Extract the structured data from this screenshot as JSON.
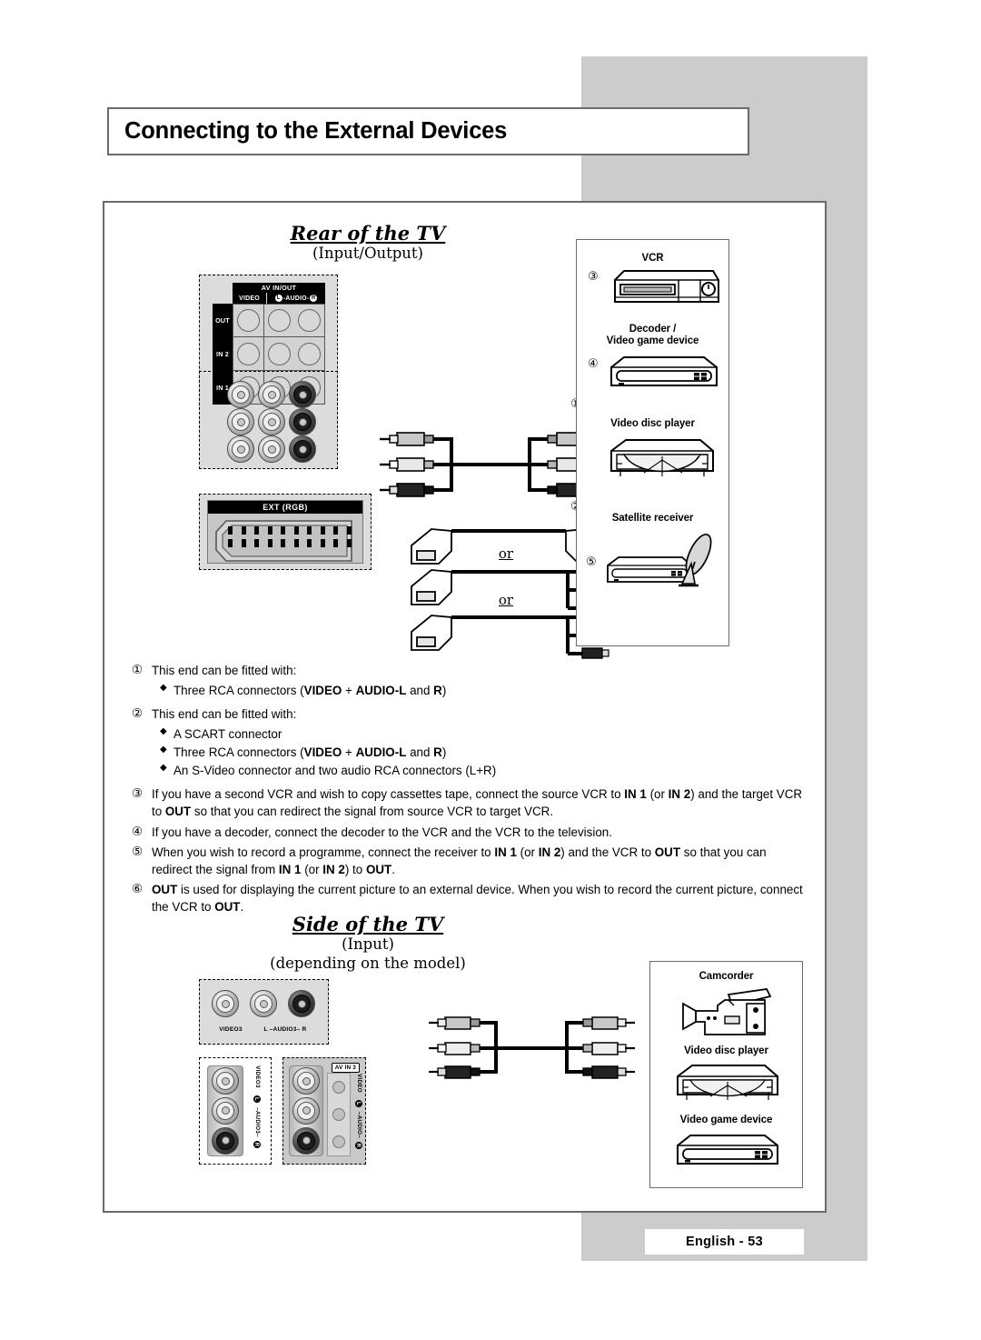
{
  "page": {
    "title": "Connecting to the External Devices",
    "footer": "English - 53"
  },
  "rear_section": {
    "heading": "Rear of the TV",
    "subheading": "(Input/Output)",
    "av_panel": {
      "title": "AV IN/OUT",
      "col_video": "VIDEO",
      "col_audio_left": "L",
      "col_audio_text": "-AUDIO-",
      "col_audio_right": "R",
      "rows": [
        "OUT",
        "IN 2",
        "IN 1"
      ]
    },
    "ext_connector": {
      "label": "EXT (RGB)"
    },
    "cable_marks": {
      "end_one": "①",
      "end_two": "②"
    },
    "or_labels": [
      "or",
      "or"
    ],
    "devices": [
      {
        "num": "③",
        "label": "VCR",
        "icon": "vcr-icon"
      },
      {
        "num": "④",
        "label": "Decoder /\nVideo game device",
        "label_line1": "Decoder /",
        "label_line2": "Video game device",
        "icon": "decoder-icon"
      },
      {
        "num": "",
        "label": "Video disc player",
        "icon": "video-disc-player-icon"
      },
      {
        "num": "⑤",
        "label": "Satellite receiver",
        "icon": "satellite-receiver-icon"
      }
    ]
  },
  "notes": [
    {
      "num": "①",
      "text": "This end can be fitted with:",
      "bullets": [
        {
          "parts": [
            {
              "t": "Three RCA connectors (",
              "b": false
            },
            {
              "t": "VIDEO",
              "b": true
            },
            {
              "t": " + ",
              "b": false
            },
            {
              "t": "AUDIO",
              "b": true
            },
            {
              "t": "-L",
              "b": true
            },
            {
              "t": " and ",
              "b": false
            },
            {
              "t": "R",
              "b": true
            },
            {
              "t": ")",
              "b": false
            }
          ]
        }
      ]
    },
    {
      "num": "②",
      "text": "This end can be fitted with:",
      "bullets": [
        {
          "parts": [
            {
              "t": "A SCART connector",
              "b": false
            }
          ]
        },
        {
          "parts": [
            {
              "t": "Three RCA connectors (",
              "b": false
            },
            {
              "t": "VIDEO",
              "b": true
            },
            {
              "t": " + ",
              "b": false
            },
            {
              "t": "AUDIO",
              "b": true
            },
            {
              "t": "-L",
              "b": true
            },
            {
              "t": " and ",
              "b": false
            },
            {
              "t": "R",
              "b": true
            },
            {
              "t": ")",
              "b": false
            }
          ]
        },
        {
          "parts": [
            {
              "t": "An S-Video connector and two audio RCA connectors (L+R)",
              "b": false
            }
          ]
        }
      ]
    },
    {
      "num": "③",
      "parts": [
        {
          "t": "If you have a second VCR and wish to copy cassettes tape, connect the source VCR to ",
          "b": false
        },
        {
          "t": "IN 1",
          "b": true
        },
        {
          "t": " (or ",
          "b": false
        },
        {
          "t": "IN 2",
          "b": true
        },
        {
          "t": ") and the target VCR to ",
          "b": false
        },
        {
          "t": "OUT",
          "b": true
        },
        {
          "t": " so that you can redirect the signal from source VCR to target VCR.",
          "b": false
        }
      ]
    },
    {
      "num": "④",
      "parts": [
        {
          "t": "If you have a decoder, connect the decoder to the VCR and the VCR to the television.",
          "b": false
        }
      ]
    },
    {
      "num": "⑤",
      "parts": [
        {
          "t": "When you wish to record a programme, connect the receiver to ",
          "b": false
        },
        {
          "t": "IN 1",
          "b": true
        },
        {
          "t": " (or ",
          "b": false
        },
        {
          "t": "IN 2",
          "b": true
        },
        {
          "t": ") and the VCR to ",
          "b": false
        },
        {
          "t": "OUT",
          "b": true
        },
        {
          "t": " so that you can redirect the signal from ",
          "b": false
        },
        {
          "t": "IN 1",
          "b": true
        },
        {
          "t": " (or ",
          "b": false
        },
        {
          "t": "IN 2",
          "b": true
        },
        {
          "t": ") to ",
          "b": false
        },
        {
          "t": "OUT",
          "b": true
        },
        {
          "t": ".",
          "b": false
        }
      ]
    },
    {
      "num": "⑥",
      "parts": [
        {
          "t": "OUT",
          "b": true
        },
        {
          "t": " is used for displaying the current picture to an external device. When you wish to record the current picture, connect the VCR to ",
          "b": false
        },
        {
          "t": "OUT",
          "b": true
        },
        {
          "t": ".",
          "b": false
        }
      ]
    }
  ],
  "side_section": {
    "heading": "Side of the TV",
    "subheading": "(Input)",
    "subheading2": "(depending on the model)",
    "horizontal_panel": {
      "video_label": "VIDEO3",
      "audio_label": "L –AUDIO3– R"
    },
    "vertical_panel_1": {
      "video_label": "VIDEO3",
      "audio_left": "L",
      "audio_text": "–AUDIO3–",
      "audio_right": "R"
    },
    "vertical_panel_2": {
      "tag": "AV IN 3",
      "video_label": "VIDEO",
      "audio_left": "L",
      "audio_text": "–AUDIO–",
      "audio_right": "R"
    },
    "devices": [
      {
        "label": "Camcorder",
        "icon": "camcorder-icon"
      },
      {
        "label": "Video disc player",
        "icon": "video-disc-player-icon"
      },
      {
        "label": "Video game device",
        "icon": "video-game-device-icon"
      }
    ]
  }
}
